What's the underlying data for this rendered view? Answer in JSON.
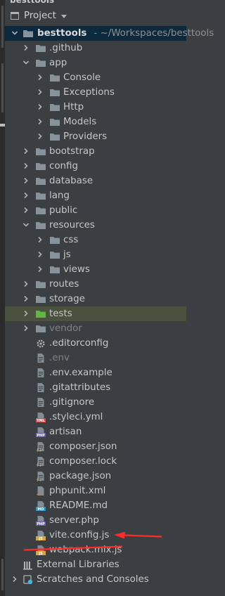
{
  "app": {
    "window_title": "besttools"
  },
  "header": {
    "title": "Project"
  },
  "tree": [
    {
      "label": "besttools",
      "path": "- ~/Workspaces/besttools",
      "indent": 0,
      "type": "root",
      "expanded": true,
      "selected": true
    },
    {
      "label": ".github",
      "indent": 1,
      "type": "folder",
      "expanded": false
    },
    {
      "label": "app",
      "indent": 1,
      "type": "folder",
      "expanded": true
    },
    {
      "label": "Console",
      "indent": 2,
      "type": "folder",
      "expanded": false
    },
    {
      "label": "Exceptions",
      "indent": 2,
      "type": "folder",
      "expanded": false
    },
    {
      "label": "Http",
      "indent": 2,
      "type": "folder",
      "expanded": false
    },
    {
      "label": "Models",
      "indent": 2,
      "type": "folder",
      "expanded": false
    },
    {
      "label": "Providers",
      "indent": 2,
      "type": "folder",
      "expanded": false
    },
    {
      "label": "bootstrap",
      "indent": 1,
      "type": "folder",
      "expanded": false
    },
    {
      "label": "config",
      "indent": 1,
      "type": "folder",
      "expanded": false
    },
    {
      "label": "database",
      "indent": 1,
      "type": "folder",
      "expanded": false
    },
    {
      "label": "lang",
      "indent": 1,
      "type": "folder",
      "expanded": false
    },
    {
      "label": "public",
      "indent": 1,
      "type": "folder",
      "expanded": false
    },
    {
      "label": "resources",
      "indent": 1,
      "type": "folder",
      "expanded": true
    },
    {
      "label": "css",
      "indent": 2,
      "type": "folder",
      "expanded": false
    },
    {
      "label": "js",
      "indent": 2,
      "type": "folder",
      "expanded": false
    },
    {
      "label": "views",
      "indent": 2,
      "type": "folder",
      "expanded": false
    },
    {
      "label": "routes",
      "indent": 1,
      "type": "folder",
      "expanded": false
    },
    {
      "label": "storage",
      "indent": 1,
      "type": "folder",
      "expanded": false
    },
    {
      "label": "tests",
      "indent": 1,
      "type": "folder-green",
      "expanded": false,
      "highlight": true
    },
    {
      "label": "vendor",
      "indent": 1,
      "type": "folder",
      "expanded": false,
      "dim": true
    },
    {
      "label": ".editorconfig",
      "indent": 1,
      "type": "gear"
    },
    {
      "label": ".env",
      "indent": 1,
      "type": "text",
      "dim": true
    },
    {
      "label": ".env.example",
      "indent": 1,
      "type": "text"
    },
    {
      "label": ".gitattributes",
      "indent": 1,
      "type": "text"
    },
    {
      "label": ".gitignore",
      "indent": 1,
      "type": "text"
    },
    {
      "label": ".styleci.yml",
      "indent": 1,
      "type": "yml",
      "badge": "YML"
    },
    {
      "label": "artisan",
      "indent": 1,
      "type": "php",
      "badge": "PHP"
    },
    {
      "label": "composer.json",
      "indent": 1,
      "type": "json"
    },
    {
      "label": "composer.lock",
      "indent": 1,
      "type": "json"
    },
    {
      "label": "package.json",
      "indent": 1,
      "type": "json"
    },
    {
      "label": "phpunit.xml",
      "indent": 1,
      "type": "xml"
    },
    {
      "label": "README.md",
      "indent": 1,
      "type": "md",
      "badge": "MD"
    },
    {
      "label": "server.php",
      "indent": 1,
      "type": "php",
      "badge": "PHP"
    },
    {
      "label": "vite.config.js",
      "indent": 1,
      "type": "js",
      "badge": "JS"
    },
    {
      "label": "webpack.mix.js",
      "indent": 1,
      "type": "js",
      "badge": "JS"
    },
    {
      "label": "External Libraries",
      "indent": 0,
      "type": "libraries",
      "expanded": false
    },
    {
      "label": "Scratches and Consoles",
      "indent": 0,
      "type": "scratches",
      "expanded": false
    }
  ],
  "annotations": {
    "arrow_target": "vite.config.js",
    "strikethrough_target": "webpack.mix.js",
    "color": "#ff2b2b"
  },
  "colors": {
    "background": "#3c3f41",
    "selected_row": "#0d293e",
    "highlight_row": "#48523e",
    "folder": "#87939a",
    "folder_green": "#62b543"
  }
}
